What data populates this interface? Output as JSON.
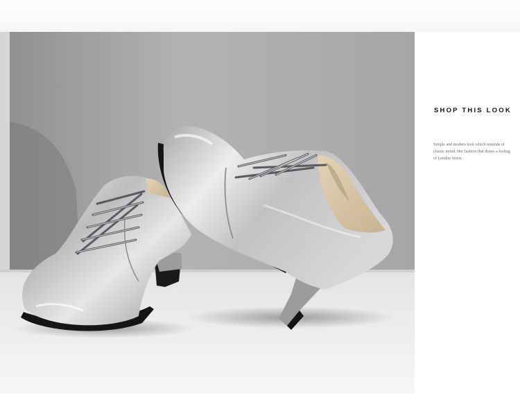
{
  "product_view": {
    "image_alt": "Silver metallic lace-up block-heel ankle shoes",
    "colors": {
      "wall": "#a9a9ab",
      "floor": "#ececec",
      "leather_silver": "#c8c8ca",
      "lining": "#d9c7a8",
      "sole": "#151515"
    }
  },
  "shop_panel": {
    "title": "SHOP THIS LOOK",
    "description": "Simple and modern look which reminds of classic mood. Her fashion that draws a feeling of London Street."
  }
}
